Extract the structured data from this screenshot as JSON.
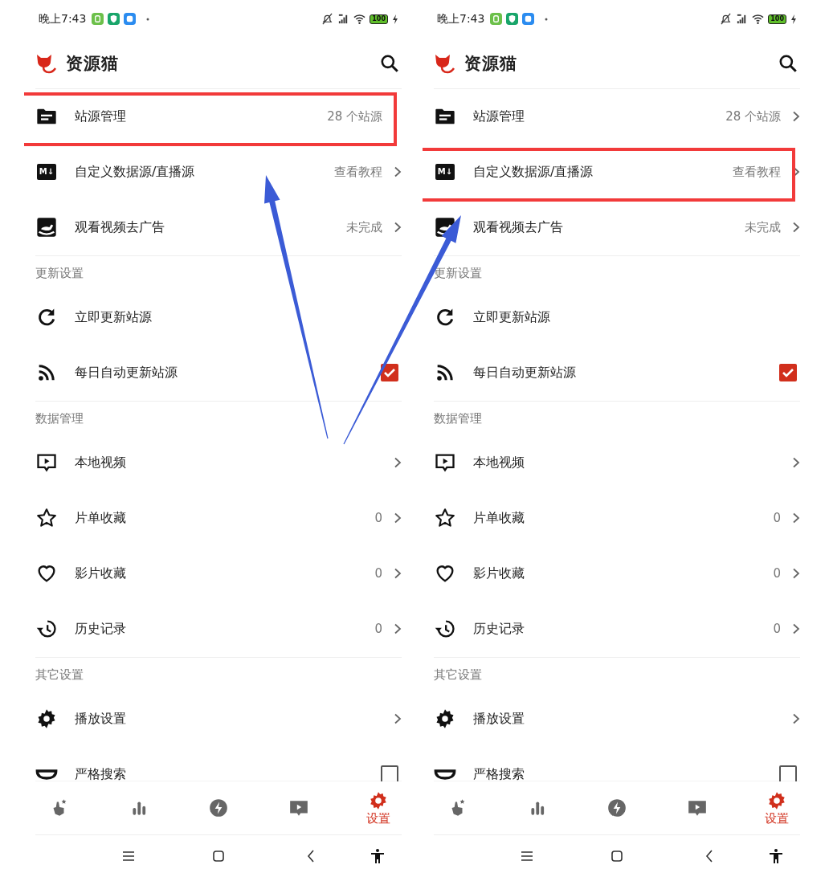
{
  "phones": [
    {
      "status_bar": {
        "time": "晚上7:43",
        "battery": "100"
      },
      "app_bar": {
        "title": "资源猫"
      },
      "sections": [
        {
          "rows": [
            {
              "kind": "nav",
              "label": "站源管理",
              "value": "28 个站源",
              "chevron": false,
              "highlighted": true
            },
            {
              "kind": "nav",
              "icon_text": "M↓",
              "label": "自定义数据源/直播源",
              "value": "查看教程",
              "chevron": true,
              "highlighted": false
            },
            {
              "kind": "nav",
              "label": "观看视频去广告",
              "value": "未完成",
              "chevron": true,
              "highlighted": false
            }
          ]
        },
        {
          "header": "更新设置",
          "rows": [
            {
              "kind": "action",
              "label": "立即更新站源",
              "highlighted": false
            },
            {
              "kind": "check",
              "label": "每日自动更新站源",
              "checked": true,
              "highlighted": false
            }
          ]
        },
        {
          "header": "数据管理",
          "rows": [
            {
              "kind": "nav",
              "label": "本地视频",
              "chevron": true,
              "highlighted": false
            },
            {
              "kind": "nav",
              "label": "片单收藏",
              "value": "0",
              "chevron": true,
              "highlighted": false
            },
            {
              "kind": "nav",
              "label": "影片收藏",
              "value": "0",
              "chevron": true,
              "highlighted": false
            },
            {
              "kind": "nav",
              "label": "历史记录",
              "value": "0",
              "chevron": true,
              "highlighted": false
            }
          ]
        },
        {
          "header": "其它设置",
          "rows": [
            {
              "kind": "nav",
              "label": "播放设置",
              "chevron": true,
              "highlighted": false
            },
            {
              "kind": "check",
              "label": "严格搜索",
              "checked": false,
              "highlighted": false
            }
          ]
        }
      ],
      "bottom_nav": [
        {
          "selected": false
        },
        {
          "selected": false
        },
        {
          "selected": false
        },
        {
          "selected": false
        },
        {
          "label": "设置",
          "selected": true
        }
      ]
    },
    {
      "status_bar": {
        "time": "晚上7:43",
        "battery": "100"
      },
      "app_bar": {
        "title": "资源猫"
      },
      "sections": [
        {
          "rows": [
            {
              "kind": "nav",
              "label": "站源管理",
              "value": "28 个站源",
              "chevron": true,
              "highlighted": false
            },
            {
              "kind": "nav",
              "icon_text": "M↓",
              "label": "自定义数据源/直播源",
              "value": "查看教程",
              "chevron": true,
              "highlighted": true
            },
            {
              "kind": "nav",
              "label": "观看视频去广告",
              "value": "未完成",
              "chevron": true,
              "highlighted": false
            }
          ]
        },
        {
          "header": "更新设置",
          "rows": [
            {
              "kind": "action",
              "label": "立即更新站源",
              "highlighted": false
            },
            {
              "kind": "check",
              "label": "每日自动更新站源",
              "checked": true,
              "highlighted": false
            }
          ]
        },
        {
          "header": "数据管理",
          "rows": [
            {
              "kind": "nav",
              "label": "本地视频",
              "chevron": true,
              "highlighted": false
            },
            {
              "kind": "nav",
              "label": "片单收藏",
              "value": "0",
              "chevron": true,
              "highlighted": false
            },
            {
              "kind": "nav",
              "label": "影片收藏",
              "value": "0",
              "chevron": true,
              "highlighted": false
            },
            {
              "kind": "nav",
              "label": "历史记录",
              "value": "0",
              "chevron": true,
              "highlighted": false
            }
          ]
        },
        {
          "header": "其它设置",
          "rows": [
            {
              "kind": "nav",
              "label": "播放设置",
              "chevron": true,
              "highlighted": false
            },
            {
              "kind": "check",
              "label": "严格搜索",
              "checked": false,
              "highlighted": false
            }
          ]
        }
      ],
      "bottom_nav": [
        {
          "selected": false
        },
        {
          "selected": false
        },
        {
          "selected": false
        },
        {
          "selected": false
        },
        {
          "label": "设置",
          "selected": true
        }
      ]
    }
  ]
}
